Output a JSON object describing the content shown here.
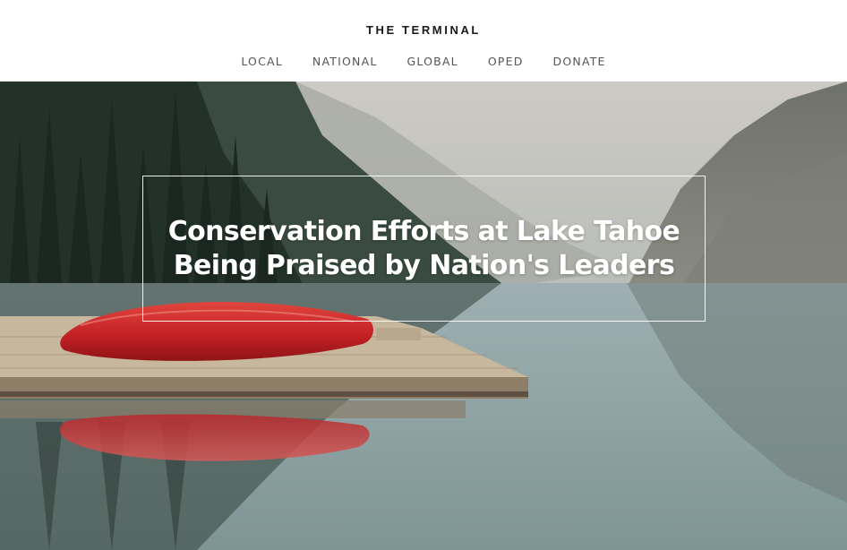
{
  "site": {
    "title": "THE TERMINAL"
  },
  "nav": {
    "items": [
      {
        "label": "LOCAL"
      },
      {
        "label": "NATIONAL"
      },
      {
        "label": "GLOBAL"
      },
      {
        "label": "OPED"
      },
      {
        "label": "DONATE"
      }
    ]
  },
  "hero": {
    "headline": "Conservation Efforts at Lake Tahoe Being Praised by Nation's Leaders",
    "image_subject": "lake-with-red-canoe-on-dock",
    "colors": {
      "canoe": "#c8262a",
      "water": "#9fb1b4",
      "sky": "#c9c7c1",
      "forest": "#2c3b33",
      "dock": "#b9a98f"
    }
  }
}
